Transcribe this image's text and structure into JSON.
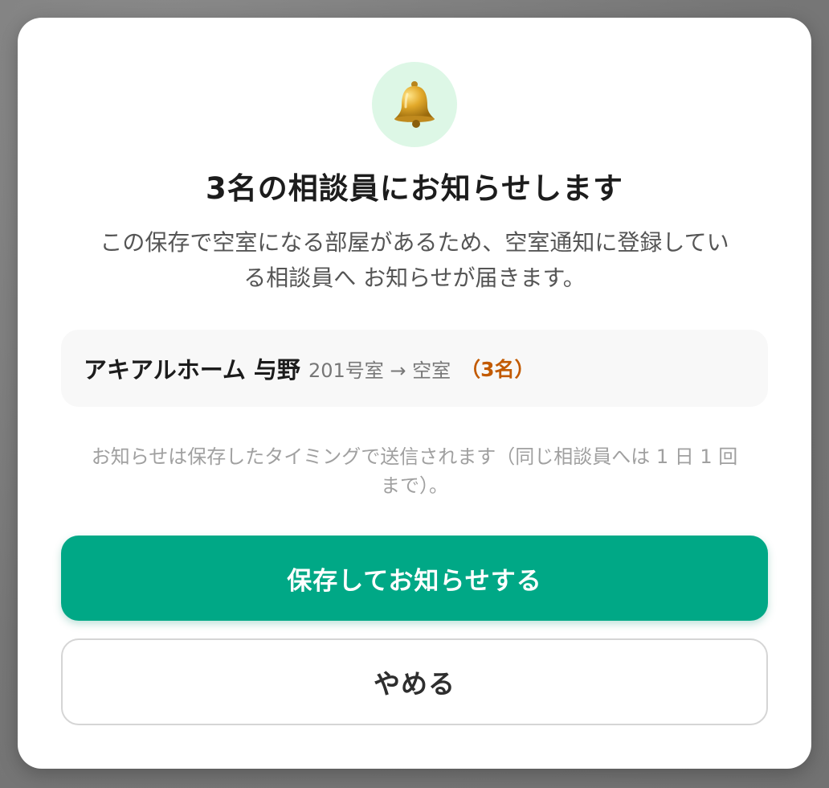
{
  "dialog": {
    "icon": "bell-icon",
    "title": "3名の相談員にお知らせします",
    "description_line1": "この保存で空室になる部屋があるため、空室通知に登録してい",
    "description_line2": "る相談員へ お知らせが届きます。",
    "room": {
      "name": "アキアルホーム 与野",
      "detail": "201号室 → 空室",
      "count": "（3名）"
    },
    "note_line1": "お知らせは保存したタイミングで送信されます（同じ相談員へは 1 日 1 回",
    "note_line2": "まで）。",
    "primary_button": "保存してお知らせする",
    "secondary_button": "やめる"
  },
  "colors": {
    "accent": "#00a886",
    "icon_bg": "#ddf7e6",
    "count": "#c25a00"
  }
}
